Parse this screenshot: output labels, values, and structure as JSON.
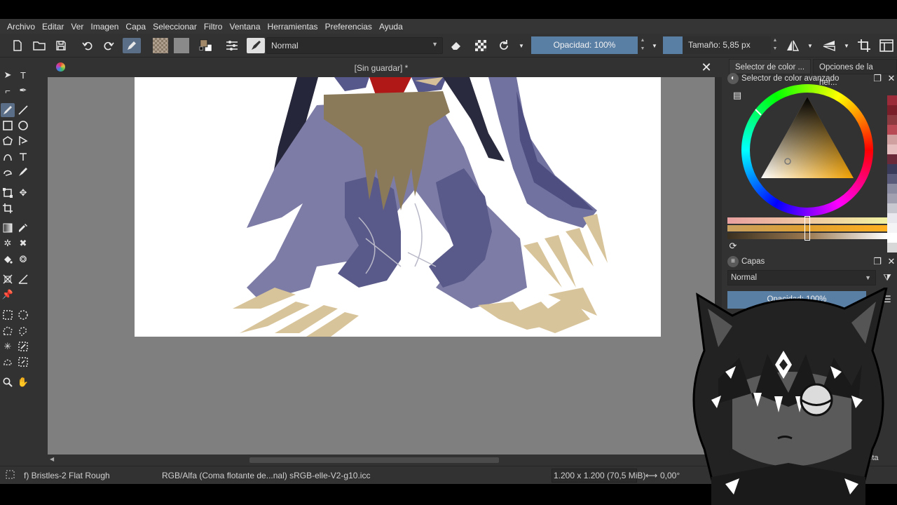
{
  "menu": [
    "Archivo",
    "Editar",
    "Ver",
    "Imagen",
    "Capa",
    "Seleccionar",
    "Filtro",
    "Ventana",
    "Herramientas",
    "Preferencias",
    "Ayuda"
  ],
  "toolbar": {
    "blend_mode": "Normal",
    "opacity_label": "Opacidad: 100%",
    "size_label": "Tamaño: 5,85 px"
  },
  "document": {
    "title": "[Sin guardar]  *"
  },
  "dock": {
    "tab_color_selector": "Selector de color ...",
    "tab_tool_options": "Opciones de la her...",
    "color_panel_title": "Selector de color avanzado",
    "layers_panel_title": "Capas",
    "layer_blend_mode": "Normal",
    "layer_opacity_label": "Opacidad:  100%",
    "partial_label": "queta"
  },
  "status": {
    "brush_preset": "f) Bristles-2 Flat Rough",
    "color_model": "RGB/Alfa (Coma flotante de...nal)  sRGB-elle-V2-g10.icc",
    "image_size": "1.200 x 1.200 (70,5 MiB)",
    "rotation": "0,00°"
  },
  "colors": {
    "accent": "#5a7fa5",
    "ui_bg": "#323232",
    "canvas_bg": "#7f7f7f",
    "paper": "#ffffff"
  },
  "palette": [
    "#9c2b3a",
    "#7a1f2a",
    "#8c3a40",
    "#b84a55",
    "#d0a0a0",
    "#e6c0c0",
    "#6a2a3a",
    "#3a3a5a",
    "#5a5a7a",
    "#8a8aa0",
    "#a0a0b0",
    "#c8c8d0",
    "#e8e8ee",
    "#f4f4f6",
    "#ffffff",
    "#d8d8d8"
  ]
}
